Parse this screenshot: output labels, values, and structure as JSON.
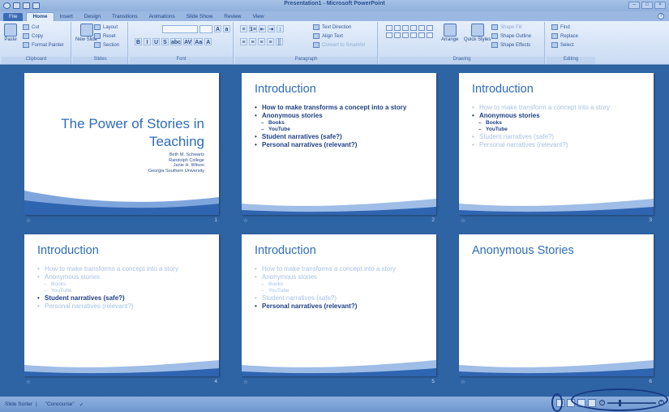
{
  "window": {
    "title": "Presentation1 - Microsoft PowerPoint",
    "controls": [
      "–",
      "□",
      "×"
    ]
  },
  "tabs": [
    "File",
    "Home",
    "Insert",
    "Design",
    "Transitions",
    "Animations",
    "Slide Show",
    "Review",
    "View"
  ],
  "active_tab": "Home",
  "ribbon": {
    "clipboard": {
      "label": "Clipboard",
      "paste": "Paste",
      "cut": "Cut",
      "copy": "Copy",
      "format_painter": "Format Painter"
    },
    "slides": {
      "label": "Slides",
      "new_slide": "New Slide",
      "layout": "Layout",
      "reset": "Reset",
      "section": "Section"
    },
    "font": {
      "label": "Font"
    },
    "paragraph": {
      "label": "Paragraph",
      "text_direction": "Text Direction",
      "align_text": "Align Text",
      "convert": "Convert to SmartArt"
    },
    "drawing": {
      "label": "Drawing",
      "arrange": "Arrange",
      "quick_styles": "Quick Styles",
      "shape_fill": "Shape Fill",
      "shape_outline": "Shape Outline",
      "shape_effects": "Shape Effects"
    },
    "editing": {
      "label": "Editing",
      "find": "Find",
      "replace": "Replace",
      "select": "Select"
    }
  },
  "slides": [
    {
      "type": "title",
      "number": "1",
      "title_lines": [
        "The Power of Stories in",
        "Teaching"
      ],
      "authors": [
        "Beth M. Schwartz",
        "Randolph College",
        "Janie H. Wilson",
        "Georgia Southern University"
      ]
    },
    {
      "type": "content",
      "number": "2",
      "title": "Introduction",
      "bullets": [
        {
          "text": "How to make transforms a concept into a story",
          "level": 1,
          "style": "strong"
        },
        {
          "text": "Anonymous stories",
          "level": 1,
          "style": "strong"
        },
        {
          "text": "Books",
          "level": 2,
          "style": "strong"
        },
        {
          "text": "YouTube",
          "level": 2,
          "style": "strong"
        },
        {
          "text": "Student narratives (safe?)",
          "level": 1,
          "style": "strong"
        },
        {
          "text": "Personal narratives (relevant?)",
          "level": 1,
          "style": "strong"
        }
      ]
    },
    {
      "type": "content",
      "number": "3",
      "title": "Introduction",
      "bullets": [
        {
          "text": "How to make transform a concept into a story",
          "level": 1,
          "style": "faded"
        },
        {
          "text": "Anonymous stories",
          "level": 1,
          "style": "strong"
        },
        {
          "text": "Books",
          "level": 2,
          "style": "strong"
        },
        {
          "text": "YouTube",
          "level": 2,
          "style": "strong"
        },
        {
          "text": "Student narratives (safe?)",
          "level": 1,
          "style": "faded"
        },
        {
          "text": "Personal narratives (relevant?)",
          "level": 1,
          "style": "faded"
        }
      ]
    },
    {
      "type": "content",
      "number": "4",
      "title": "Introduction",
      "bullets": [
        {
          "text": "How to make transforms a concept into a story",
          "level": 1,
          "style": "faded"
        },
        {
          "text": "Anonymous stories",
          "level": 1,
          "style": "faded"
        },
        {
          "text": "Books",
          "level": 2,
          "style": "faded"
        },
        {
          "text": "YouTube",
          "level": 2,
          "style": "faded"
        },
        {
          "text": "Student narratives (safe?)",
          "level": 1,
          "style": "strong"
        },
        {
          "text": "Personal narratives (relevant?)",
          "level": 1,
          "style": "faded"
        }
      ]
    },
    {
      "type": "content",
      "number": "5",
      "title": "Introduction",
      "bullets": [
        {
          "text": "How to make transforms a concept into a story",
          "level": 1,
          "style": "faded"
        },
        {
          "text": "Anonymous stories",
          "level": 1,
          "style": "faded"
        },
        {
          "text": "Books",
          "level": 2,
          "style": "faded"
        },
        {
          "text": "YouTube",
          "level": 2,
          "style": "faded"
        },
        {
          "text": "Student narratives (safe?)",
          "level": 1,
          "style": "faded"
        },
        {
          "text": "Personal narratives (relevant?)",
          "level": 1,
          "style": "strong"
        }
      ]
    },
    {
      "type": "content",
      "number": "6",
      "title": "Anonymous Stories",
      "bullets": []
    }
  ],
  "statusbar": {
    "view_label": "Slide Sorter",
    "theme": "\"Concourse\"",
    "zoom_minus": "–",
    "zoom_plus": "+"
  },
  "colors": {
    "title_blue": "#2e6db8",
    "strong_text": "#1f3f86",
    "faded_text": "#a8c1e6",
    "sorter_bg": "#2f64a4"
  }
}
